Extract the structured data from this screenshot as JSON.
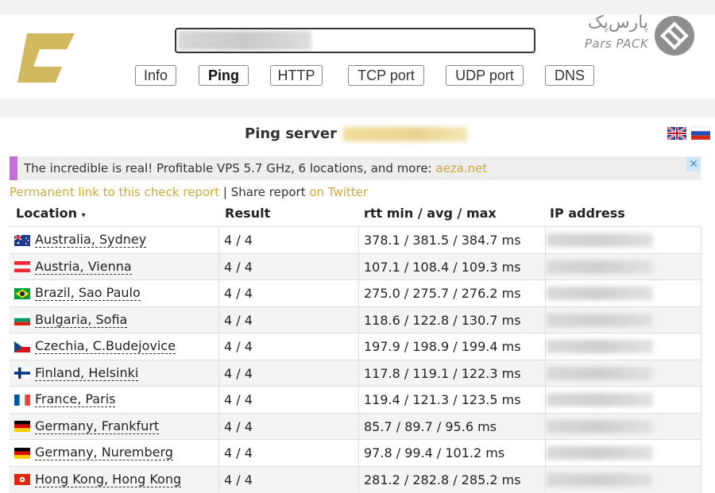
{
  "brand": {
    "parspack_fa": "پارس‌پک",
    "parspack_en": "Pars PACK",
    "logo_color": "#d2b960"
  },
  "search": {
    "value": ""
  },
  "tabs": [
    {
      "label": "Info",
      "active": false
    },
    {
      "label": "Ping",
      "active": true
    },
    {
      "label": "HTTP",
      "active": false
    },
    {
      "label": "TCP port",
      "active": false
    },
    {
      "label": "UDP port",
      "active": false
    },
    {
      "label": "DNS",
      "active": false
    }
  ],
  "title": {
    "text": "Ping server"
  },
  "ad": {
    "text": "The incredible is real! Profitable VPS 5.7 GHz, 6 locations, and more: ",
    "link": "aeza.net",
    "close": "✕"
  },
  "links": {
    "permanent": "Permanent link to this check report",
    "divider": " | ",
    "share": "Share report ",
    "twitter": "on Twitter"
  },
  "table": {
    "headers": {
      "location": "Location",
      "sort_indicator": "▾",
      "result": "Result",
      "rtt": "rtt min / avg / max",
      "ip": "IP address"
    },
    "rows": [
      {
        "flag": "au",
        "location": "Australia, Sydney",
        "result": "4 / 4",
        "rtt": "378.1 / 381.5 / 384.7 ms"
      },
      {
        "flag": "at",
        "location": "Austria, Vienna",
        "result": "4 / 4",
        "rtt": "107.1 / 108.4 / 109.3 ms"
      },
      {
        "flag": "br",
        "location": "Brazil, Sao Paulo",
        "result": "4 / 4",
        "rtt": "275.0 / 275.7 / 276.2 ms"
      },
      {
        "flag": "bg",
        "location": "Bulgaria, Sofia",
        "result": "4 / 4",
        "rtt": "118.6 / 122.8 / 130.7 ms"
      },
      {
        "flag": "cz",
        "location": "Czechia, C.Budejovice",
        "result": "4 / 4",
        "rtt": "197.9 / 198.9 / 199.4 ms"
      },
      {
        "flag": "fi",
        "location": "Finland, Helsinki",
        "result": "4 / 4",
        "rtt": "117.8 / 119.1 / 122.3 ms"
      },
      {
        "flag": "fr",
        "location": "France, Paris",
        "result": "4 / 4",
        "rtt": "119.4 / 121.3 / 123.5 ms"
      },
      {
        "flag": "de",
        "location": "Germany, Frankfurt",
        "result": "4 / 4",
        "rtt": "85.7 / 89.7 / 95.6 ms"
      },
      {
        "flag": "de",
        "location": "Germany, Nuremberg",
        "result": "4 / 4",
        "rtt": "97.8 / 99.4 / 101.2 ms"
      },
      {
        "flag": "hk",
        "location": "Hong Kong, Hong Kong",
        "result": "4 / 4",
        "rtt": "281.2 / 282.8 / 285.2 ms"
      }
    ]
  }
}
